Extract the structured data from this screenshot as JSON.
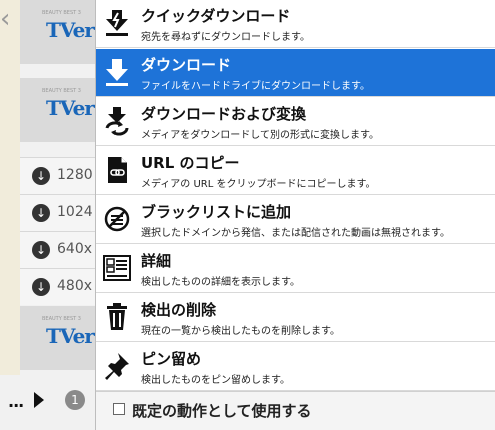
{
  "background": {
    "thumbnail_logo": "TVer",
    "thumbnail_tag": "BEAUTY BEST 3",
    "resolutions": [
      "1280",
      "1024",
      "640x",
      "480x"
    ],
    "count_badge": "1",
    "more_label": "..."
  },
  "menu": {
    "items": [
      {
        "title": "クイックダウンロード",
        "desc": "宛先を尋ねずにダウンロードします。",
        "icon": "quick-download-icon"
      },
      {
        "title": "ダウンロード",
        "desc": "ファイルをハードドライブにダウンロードします。",
        "icon": "download-arrow-icon"
      },
      {
        "title": "ダウンロードおよび変換",
        "desc": "メディアをダウンロードして別の形式に変換します。",
        "icon": "download-convert-icon"
      },
      {
        "title": "URL のコピー",
        "desc": "メディアの URL をクリップボードにコピーします。",
        "icon": "copy-url-icon"
      },
      {
        "title": "ブラックリストに追加",
        "desc": "選択したドメインから発信、または配信された動画は無視されます。",
        "icon": "blacklist-icon"
      },
      {
        "title": "詳細",
        "desc": "検出したものの詳細を表示します。",
        "icon": "details-icon"
      },
      {
        "title": "検出の削除",
        "desc": "現在の一覧から検出したものを削除します。",
        "icon": "trash-icon"
      },
      {
        "title": "ピン留め",
        "desc": "検出したものをピン留めします。",
        "icon": "pin-icon"
      }
    ],
    "footer_label": "既定の動作として使用する"
  },
  "colors": {
    "selected": "#1e73d8"
  }
}
